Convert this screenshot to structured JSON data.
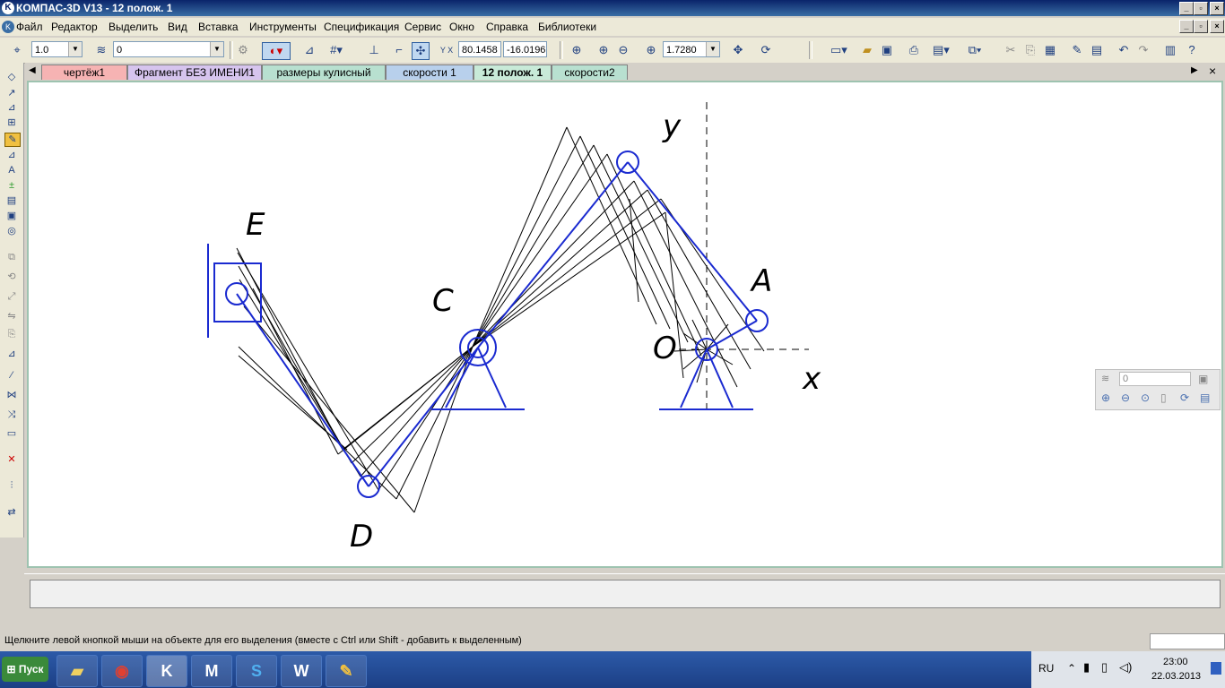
{
  "window": {
    "title": "КОМПАС-3D V13 - 12 полож. 1"
  },
  "menu": [
    "Файл",
    "Редактор",
    "Выделить",
    "Вид",
    "Вставка",
    "Инструменты",
    "Спецификация",
    "Сервис",
    "Окно",
    "Справка",
    "Библиотеки"
  ],
  "toolbar": {
    "scale": "1.0",
    "layer": "0",
    "coord_x": "80.1458",
    "coord_y": "-16.0196",
    "zoom": "1.7280"
  },
  "tabs": [
    {
      "label": "чертёж1",
      "color": "#f6b3b3"
    },
    {
      "label": "Фрагмент БЕЗ ИМЕНИ1",
      "color": "#d6c4ee"
    },
    {
      "label": "размеры кулисный",
      "color": "#b8e0d0"
    },
    {
      "label": "скорости 1",
      "color": "#b8d0ec"
    },
    {
      "label": "12 полож. 1",
      "color": "#c8ead8",
      "active": true
    },
    {
      "label": "скорости2",
      "color": "#b8e0d0"
    }
  ],
  "drawing_labels": {
    "y": "y",
    "x": "x",
    "E": "E",
    "C": "C",
    "A": "A",
    "O": "O",
    "D": "D"
  },
  "mini_panel": {
    "layer": "0"
  },
  "status": "Щелкните левой кнопкой мыши на объекте для его выделения (вместе с Ctrl или Shift - добавить к выделенным)",
  "taskbar": {
    "start": "Пуск",
    "lang": "RU",
    "time": "23:00",
    "date": "22.03.2013"
  },
  "colors": {
    "mechanism": "#1a2ad0",
    "traces": "#000000"
  }
}
